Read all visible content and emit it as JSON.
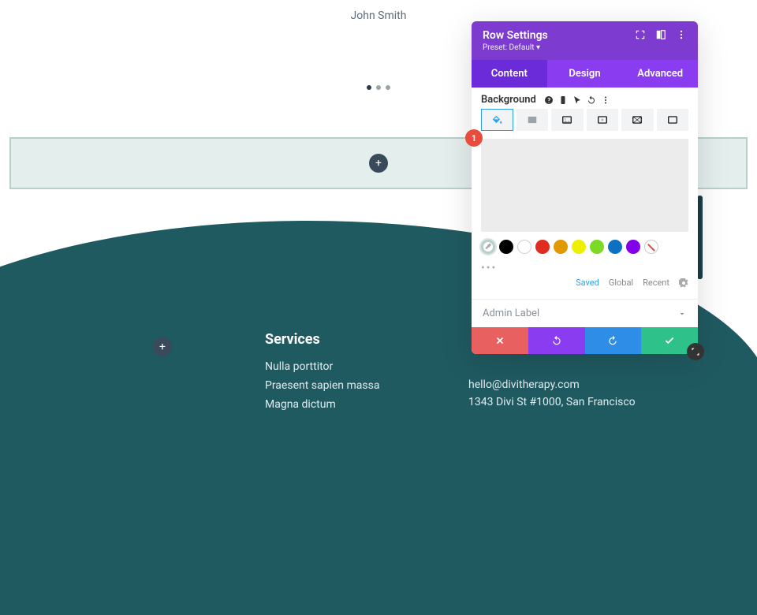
{
  "page": {
    "author": "John Smith"
  },
  "footer": {
    "services_heading": "Services",
    "services": [
      "Nulla porttitor",
      "Praesent sapien massa",
      "Magna dictum"
    ],
    "contact_email": "hello@divitherapy.com",
    "contact_addr": "1343 Divi St #1000, San Francisco"
  },
  "modal": {
    "title": "Row Settings",
    "preset": "Preset: Default ▾",
    "tabs": {
      "content": "Content",
      "design": "Design",
      "advanced": "Advanced"
    },
    "active_tab": "content",
    "background_label": "Background",
    "bg_types": [
      "color",
      "gradient",
      "image",
      "video",
      "pattern",
      "mask"
    ],
    "step_badge": "1",
    "swatches": [
      "#000000",
      "#ffffff",
      "#e02b20",
      "#e09900",
      "#edf000",
      "#7cda24",
      "#0c71c3",
      "#8300e9"
    ],
    "palette_tabs": {
      "saved": "Saved",
      "global": "Global",
      "recent": "Recent"
    },
    "admin_label": "Admin Label"
  }
}
